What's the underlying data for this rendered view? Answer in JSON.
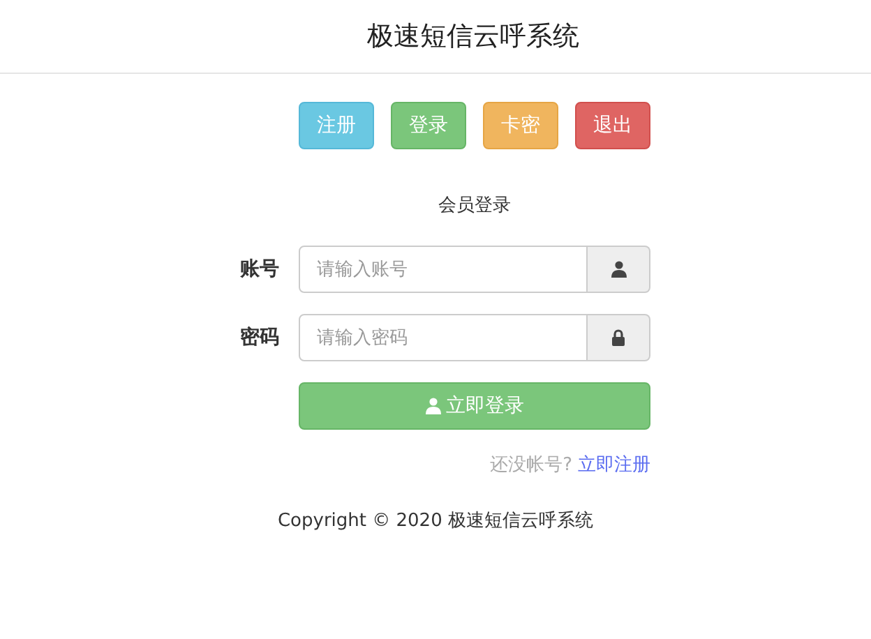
{
  "header": {
    "title": "极速短信云呼系统"
  },
  "nav_buttons": [
    {
      "label": "注册",
      "kind": "info"
    },
    {
      "label": "登录",
      "kind": "success"
    },
    {
      "label": "卡密",
      "kind": "warning"
    },
    {
      "label": "退出",
      "kind": "danger"
    }
  ],
  "form": {
    "title": "会员登录",
    "fields": [
      {
        "label": "账号",
        "placeholder": "请输入账号",
        "kind": "user"
      },
      {
        "label": "密码",
        "placeholder": "请输入密码",
        "kind": "lock"
      }
    ],
    "submit": "立即登录",
    "register_prompt": "还没帐号?",
    "register_link": "立即注册"
  },
  "footer": {
    "copyright": "Copyright © 2020 极速短信云呼系统"
  }
}
